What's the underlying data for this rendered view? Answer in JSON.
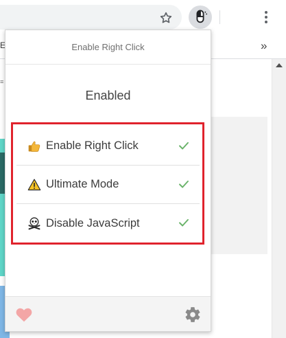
{
  "browser": {
    "bookmark_letter": "E",
    "bookmarks_overflow": "»"
  },
  "popup": {
    "header_title": "Enable Right Click",
    "status": "Enabled",
    "options": [
      {
        "label": "Enable Right Click",
        "icon": "thumbs-up-icon",
        "checked": true
      },
      {
        "label": "Ultimate Mode",
        "icon": "warning-icon",
        "checked": true
      },
      {
        "label": "Disable JavaScript",
        "icon": "skull-crossbones-icon",
        "checked": true
      }
    ],
    "footer": {
      "left_icon": "heart-icon",
      "right_icon": "gear-icon"
    }
  },
  "colors": {
    "highlight_border": "#e0232d",
    "check": "#6ab36a",
    "heart": "#f3a6a6",
    "gear": "#8a8a8a"
  }
}
